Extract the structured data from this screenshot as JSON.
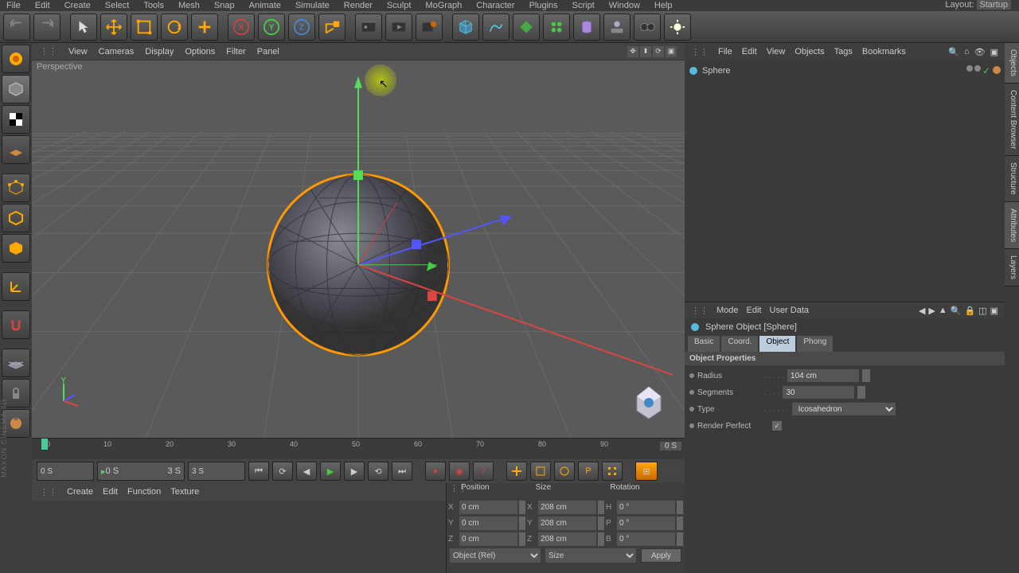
{
  "layout": {
    "label": "Layout:",
    "value": "Startup"
  },
  "menubar": [
    "File",
    "Edit",
    "Create",
    "Select",
    "Tools",
    "Mesh",
    "Snap",
    "Animate",
    "Simulate",
    "Render",
    "Sculpt",
    "MoGraph",
    "Character",
    "Plugins",
    "Script",
    "Window",
    "Help"
  ],
  "viewportMenus": [
    "View",
    "Cameras",
    "Display",
    "Options",
    "Filter",
    "Panel"
  ],
  "viewportLabel": "Perspective",
  "timeline": {
    "ticks": [
      0,
      10,
      20,
      30,
      40,
      50,
      60,
      70,
      80,
      90
    ],
    "end": "0 S"
  },
  "playback": {
    "start": "0 S",
    "cur": "0 S",
    "curEnd": "3 S",
    "end": "3 S"
  },
  "commandMenus": [
    "Create",
    "Edit",
    "Function",
    "Texture"
  ],
  "coord": {
    "headers": [
      "Position",
      "Size",
      "Rotation"
    ],
    "rows": [
      {
        "axis": "X",
        "pos": "0 cm",
        "sizeAxis": "X",
        "size": "208 cm",
        "rotAxis": "H",
        "rot": "0 °"
      },
      {
        "axis": "Y",
        "pos": "0 cm",
        "sizeAxis": "Y",
        "size": "208 cm",
        "rotAxis": "P",
        "rot": "0 °"
      },
      {
        "axis": "Z",
        "pos": "0 cm",
        "sizeAxis": "Z",
        "size": "208 cm",
        "rotAxis": "B",
        "rot": "0 °"
      }
    ],
    "dropdowns": [
      "Object (Rel)",
      "Size"
    ],
    "apply": "Apply"
  },
  "objMgr": {
    "menus": [
      "File",
      "Edit",
      "View",
      "Objects",
      "Tags",
      "Bookmarks"
    ],
    "items": [
      {
        "name": "Sphere"
      }
    ]
  },
  "attrMgr": {
    "menus": [
      "Mode",
      "Edit",
      "User Data"
    ],
    "title": "Sphere Object [Sphere]",
    "tabs": [
      "Basic",
      "Coord.",
      "Object",
      "Phong"
    ],
    "activeTab": 2,
    "section": "Object Properties",
    "props": {
      "radius": {
        "label": "Radius",
        "value": "104 cm"
      },
      "segments": {
        "label": "Segments",
        "value": "30"
      },
      "type": {
        "label": "Type",
        "value": "Icosahedron"
      },
      "renderPerfect": {
        "label": "Render Perfect",
        "checked": true
      }
    }
  },
  "sideTabs": [
    "Objects",
    "Content Browser",
    "Structure",
    "Attributes",
    "Layers"
  ],
  "watermark": "MAXON CINEMA 4D"
}
